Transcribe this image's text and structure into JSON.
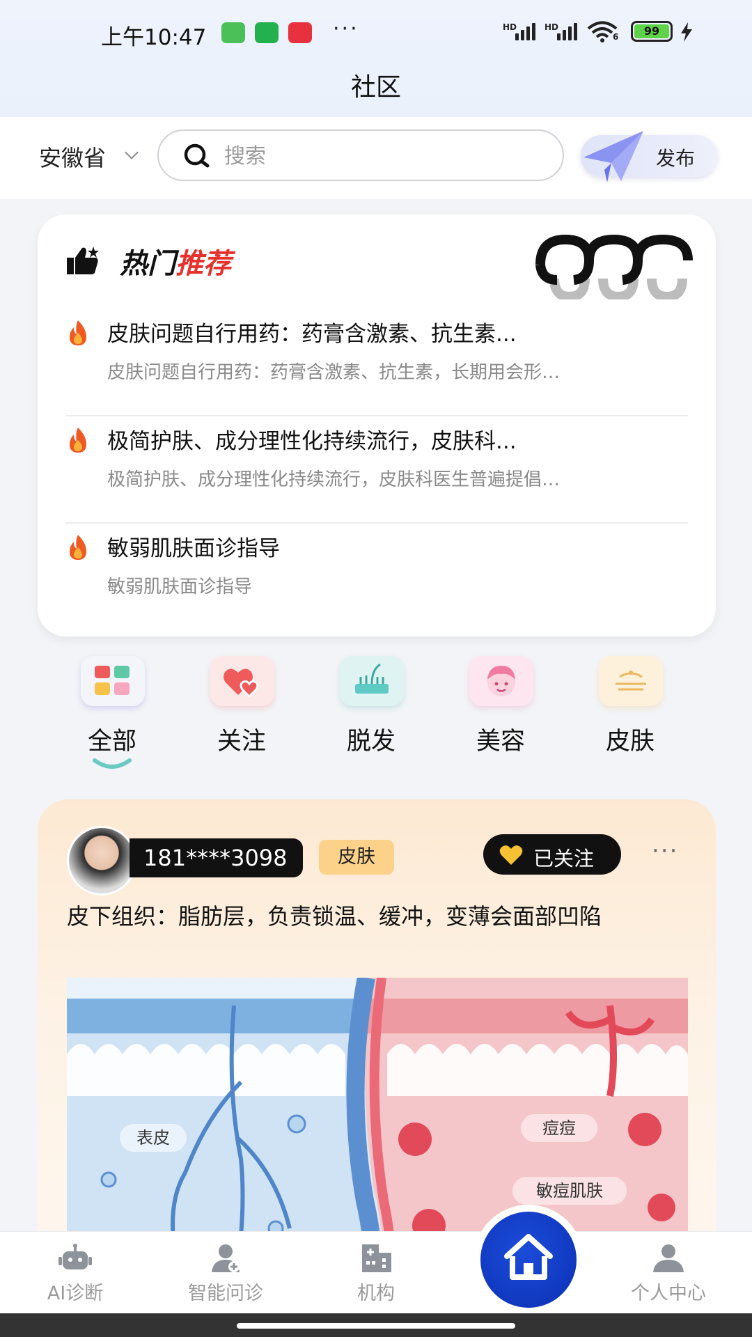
{
  "status_bar": {
    "time": "上午10:47",
    "sig1": "HD",
    "sig2": "HD",
    "wifi_level": "6",
    "battery": "99",
    "more": "···"
  },
  "header": {
    "title": "社区"
  },
  "search_row": {
    "province": "安徽省",
    "search_placeholder": "搜索",
    "publish_label": "发布"
  },
  "hot": {
    "title_part1": "热门",
    "title_part2": "推荐",
    "items": [
      {
        "title": "皮肤问题自行用药：药膏含激素、抗生素...",
        "desc": "皮肤问题自行用药：药膏含激素、抗生素，长期用会形…"
      },
      {
        "title": "极简护肤、成分理性化持续流行，皮肤科...",
        "desc": "极简护肤、成分理性化持续流行，皮肤科医生普遍提倡…"
      },
      {
        "title": "敏弱肌肤面诊指导",
        "desc": "敏弱肌肤面诊指导"
      }
    ]
  },
  "categories": [
    {
      "label": "全部",
      "active": true
    },
    {
      "label": "关注",
      "active": false
    },
    {
      "label": "脱发",
      "active": false
    },
    {
      "label": "美容",
      "active": false
    },
    {
      "label": "皮肤",
      "active": false
    }
  ],
  "post": {
    "user": "181****3098",
    "tag": "皮肤",
    "follow_label": "已关注",
    "more": "···",
    "text": "皮下组织：脂肪层，负责锁温、缓冲，变薄会面部凹陷",
    "image_labels": {
      "left": "表皮",
      "right1": "痘痘",
      "right2": "敏痘肌肤"
    }
  },
  "tabbar": {
    "items": [
      {
        "label": "AI诊断"
      },
      {
        "label": "智能问诊"
      },
      {
        "label": "机构"
      },
      {
        "label": "个人中心"
      }
    ]
  },
  "colors": {
    "accent": "#0b30b4",
    "hot_red": "#e5322d",
    "tag_bg": "#fcd28b"
  }
}
